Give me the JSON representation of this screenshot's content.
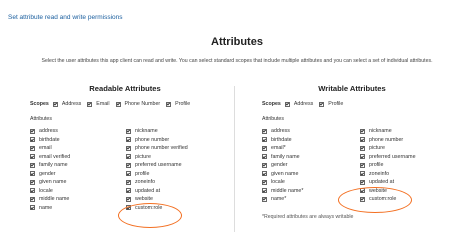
{
  "header": {
    "link_label": "Set attribute read and write permissions",
    "title": "Attributes",
    "description": "Select the user attributes this app client can read and write. You can select standard scopes that include multiple attributes and you can select a set of individual attributes."
  },
  "readable": {
    "title": "Readable Attributes",
    "scopes_label": "Scopes",
    "scopes": [
      {
        "label": "Address",
        "checked": true
      },
      {
        "label": "Email",
        "checked": true
      },
      {
        "label": "Phone Number",
        "checked": true
      },
      {
        "label": "Profile",
        "checked": true
      }
    ],
    "attributes_label": "Attributes",
    "col1": [
      {
        "label": "address",
        "checked": true
      },
      {
        "label": "birthdate",
        "checked": true
      },
      {
        "label": "email",
        "checked": true
      },
      {
        "label": "email verified",
        "checked": true
      },
      {
        "label": "family name",
        "checked": true
      },
      {
        "label": "gender",
        "checked": true
      },
      {
        "label": "given name",
        "checked": true
      },
      {
        "label": "locale",
        "checked": true
      },
      {
        "label": "middle name",
        "checked": true
      },
      {
        "label": "name",
        "checked": true
      }
    ],
    "col2": [
      {
        "label": "nickname",
        "checked": true
      },
      {
        "label": "phone number",
        "checked": true
      },
      {
        "label": "phone number verified",
        "checked": true
      },
      {
        "label": "picture",
        "checked": true
      },
      {
        "label": "preferred username",
        "checked": true
      },
      {
        "label": "profile",
        "checked": true
      },
      {
        "label": "zoneinfo",
        "checked": true
      },
      {
        "label": "updated at",
        "checked": true
      },
      {
        "label": "website",
        "checked": true
      },
      {
        "label": "custom:role",
        "checked": true
      }
    ]
  },
  "writable": {
    "title": "Writable Attributes",
    "scopes_label": "Scopes",
    "scopes": [
      {
        "label": "Address",
        "checked": true
      },
      {
        "label": "Profile",
        "checked": true
      }
    ],
    "attributes_label": "Attributes",
    "col1": [
      {
        "label": "address",
        "checked": true
      },
      {
        "label": "birthdate",
        "checked": true
      },
      {
        "label": "email*",
        "checked": true
      },
      {
        "label": "family name",
        "checked": true
      },
      {
        "label": "gender",
        "checked": true
      },
      {
        "label": "given name",
        "checked": true
      },
      {
        "label": "locale",
        "checked": true
      },
      {
        "label": "middle name*",
        "checked": true
      },
      {
        "label": "name*",
        "checked": true
      }
    ],
    "col2": [
      {
        "label": "nickname",
        "checked": true
      },
      {
        "label": "phone number",
        "checked": true
      },
      {
        "label": "picture",
        "checked": true
      },
      {
        "label": "preferred username",
        "checked": true
      },
      {
        "label": "profile",
        "checked": true
      },
      {
        "label": "zoneinfo",
        "checked": true
      },
      {
        "label": "updated at",
        "checked": true
      },
      {
        "label": "website",
        "checked": true
      },
      {
        "label": "custom:role",
        "checked": true
      }
    ],
    "note": "*Required attributes are always writable"
  },
  "colors": {
    "link": "#1a5e9e",
    "highlight": "#f36f21"
  }
}
